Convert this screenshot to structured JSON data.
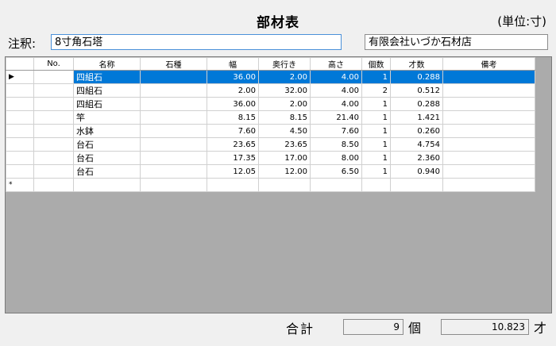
{
  "header": {
    "title": "部材表",
    "unit": "(単位:寸)",
    "note_label": "注釈:",
    "note_value": "8寸角石塔",
    "company": "有限会社いづか石材店"
  },
  "grid": {
    "columns": [
      "",
      "No.",
      "名称",
      "石種",
      "幅",
      "奥行き",
      "高さ",
      "個数",
      "才数",
      "備考"
    ],
    "rows": [
      {
        "indicator": "▶",
        "no": "",
        "name": "四組石",
        "stone": "",
        "width": "36.00",
        "depth": "2.00",
        "height": "4.00",
        "count": "1",
        "sai": "0.288",
        "note": ""
      },
      {
        "indicator": "",
        "no": "",
        "name": "四組石",
        "stone": "",
        "width": "2.00",
        "depth": "32.00",
        "height": "4.00",
        "count": "2",
        "sai": "0.512",
        "note": ""
      },
      {
        "indicator": "",
        "no": "",
        "name": "四組石",
        "stone": "",
        "width": "36.00",
        "depth": "2.00",
        "height": "4.00",
        "count": "1",
        "sai": "0.288",
        "note": ""
      },
      {
        "indicator": "",
        "no": "",
        "name": "竿",
        "stone": "",
        "width": "8.15",
        "depth": "8.15",
        "height": "21.40",
        "count": "1",
        "sai": "1.421",
        "note": ""
      },
      {
        "indicator": "",
        "no": "",
        "name": "水鉢",
        "stone": "",
        "width": "7.60",
        "depth": "4.50",
        "height": "7.60",
        "count": "1",
        "sai": "0.260",
        "note": ""
      },
      {
        "indicator": "",
        "no": "",
        "name": "台石",
        "stone": "",
        "width": "23.65",
        "depth": "23.65",
        "height": "8.50",
        "count": "1",
        "sai": "4.754",
        "note": ""
      },
      {
        "indicator": "",
        "no": "",
        "name": "台石",
        "stone": "",
        "width": "17.35",
        "depth": "17.00",
        "height": "8.00",
        "count": "1",
        "sai": "2.360",
        "note": ""
      },
      {
        "indicator": "",
        "no": "",
        "name": "台石",
        "stone": "",
        "width": "12.05",
        "depth": "12.00",
        "height": "6.50",
        "count": "1",
        "sai": "0.940",
        "note": ""
      },
      {
        "indicator": "*",
        "no": "",
        "name": "",
        "stone": "",
        "width": "",
        "depth": "",
        "height": "",
        "count": "",
        "sai": "",
        "note": ""
      }
    ]
  },
  "footer": {
    "total_label": "合計",
    "total_count": "9",
    "count_unit": "個",
    "total_sai": "10.823",
    "sai_unit": "才"
  },
  "colors": {
    "selection": "#0078d7",
    "grid_background": "#ababab"
  }
}
